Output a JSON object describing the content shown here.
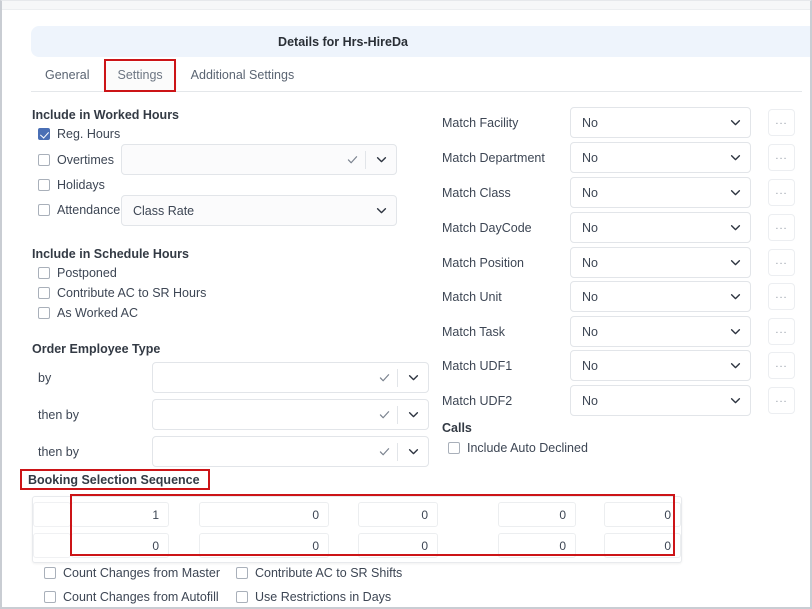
{
  "window": {
    "title": "Details for Hrs-HireDa"
  },
  "tabs": [
    {
      "label": "General",
      "selected": false
    },
    {
      "label": "Settings",
      "selected": true
    },
    {
      "label": "Additional Settings",
      "selected": false
    }
  ],
  "left": {
    "worked_hours": {
      "heading": "Include in Worked Hours",
      "reg_hours": {
        "label": "Reg. Hours",
        "checked": true
      },
      "overtimes": {
        "label": "Overtimes",
        "checked": false,
        "value": ""
      },
      "holidays": {
        "label": "Holidays",
        "checked": false
      },
      "attendance": {
        "label": "Attendance",
        "checked": false,
        "value": "Class Rate"
      }
    },
    "schedule_hours": {
      "heading": "Include in Schedule Hours",
      "items": [
        {
          "label": "Postponed",
          "checked": false
        },
        {
          "label": "Contribute AC to SR Hours",
          "checked": false
        },
        {
          "label": "As Worked AC",
          "checked": false
        }
      ]
    },
    "order_employee_type": {
      "heading": "Order Employee Type",
      "rows": [
        {
          "label": "by",
          "value": ""
        },
        {
          "label": "then by",
          "value": ""
        },
        {
          "label": "then by",
          "value": ""
        }
      ]
    }
  },
  "right": {
    "match_fields": [
      {
        "label": "Match Facility",
        "value": "No"
      },
      {
        "label": "Match Department",
        "value": "No"
      },
      {
        "label": "Match Class",
        "value": "No"
      },
      {
        "label": "Match DayCode",
        "value": "No"
      },
      {
        "label": "Match Position",
        "value": "No"
      },
      {
        "label": "Match Unit",
        "value": "No"
      },
      {
        "label": "Match Task",
        "value": "No"
      },
      {
        "label": "Match UDF1",
        "value": "No"
      },
      {
        "label": "Match UDF2",
        "value": "No"
      }
    ],
    "ellipsis_label": "...",
    "calls": {
      "heading": "Calls",
      "include_auto_declined": {
        "label": "Include Auto Declined",
        "checked": false
      }
    }
  },
  "booking": {
    "heading": "Booking Selection Sequence",
    "rows": [
      [
        "",
        "1",
        "0",
        "0",
        "0",
        "0"
      ],
      [
        "",
        "0",
        "0",
        "0",
        "0",
        "0"
      ]
    ]
  },
  "bottom_checks": [
    {
      "label": "Count Changes from Master",
      "checked": false
    },
    {
      "label": "Contribute AC to SR Shifts",
      "checked": false
    },
    {
      "label": "Count Changes from Autofill",
      "checked": false
    },
    {
      "label": "Use Restrictions in Days",
      "checked": false
    }
  ],
  "colors": {
    "highlight": "#cc1417",
    "titlebar_bg": "#eef4fc",
    "checkbox_checked": "#4a6fb5"
  }
}
